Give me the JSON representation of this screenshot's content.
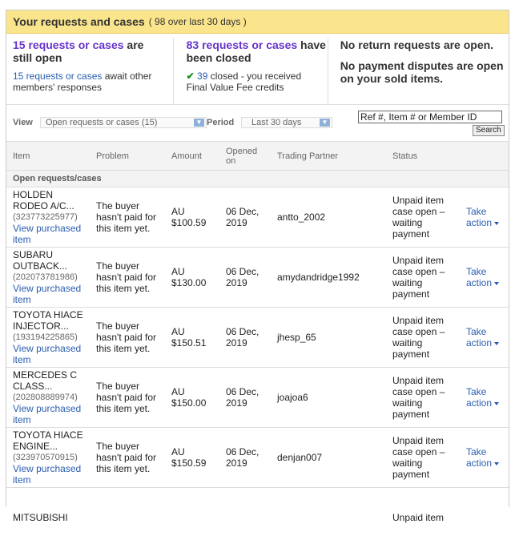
{
  "header": {
    "title": "Your requests and cases",
    "subtitle": "( 98 over last 30 days )"
  },
  "summary": {
    "open_count": "15 requests or cases",
    "open_suffix": "are",
    "open_line2": "still open",
    "await_link": "15 requests or cases",
    "await_text": "await other members' responses",
    "closed_count": "83 requests or cases",
    "closed_suffix": "have",
    "closed_line2": "been closed",
    "closed_check": "✔",
    "closed_num": "39",
    "closed_text": "closed - you received",
    "closed_text2": "Final Value Fee credits",
    "return_msg": "No return requests are open.",
    "dispute_msg": "No payment disputes are open on your sold items."
  },
  "filter": {
    "view_label": "View",
    "view_value": "Open requests or cases (15)",
    "period_label": "Period",
    "period_value": "Last 30 days",
    "search_placeholder": "Ref #, Item # or Member ID",
    "search_button": "Search"
  },
  "columns": [
    "Item",
    "Problem",
    "Amount",
    "Opened on",
    "Trading Partner",
    "Status"
  ],
  "group_label": "Open requests/cases",
  "rows": [
    {
      "name1": "HOLDEN",
      "name2": "RODEO A/C...",
      "num": "(323773225977)",
      "view": "View purchased item",
      "problem": "The buyer hasn't paid for this item yet.",
      "amount1": "AU",
      "amount2": "$100.59",
      "date1": "06 Dec,",
      "date2": "2019",
      "partner": "antto_2002",
      "status": "Unpaid item case open – waiting payment",
      "take1": "Take",
      "take2": "action"
    },
    {
      "name1": "SUBARU",
      "name2": "OUTBACK...",
      "num": "(202073781986)",
      "view": "View purchased item",
      "problem": "The buyer hasn't paid for this item yet.",
      "amount1": "AU",
      "amount2": "$130.00",
      "date1": "06 Dec,",
      "date2": "2019",
      "partner": "amydandridge1992",
      "status": "Unpaid item case open – waiting payment",
      "take1": "Take",
      "take2": "action"
    },
    {
      "name1": "TOYOTA HIACE",
      "name2": "INJECTOR...",
      "num": "(193194225865)",
      "view": "View purchased item",
      "problem": "The buyer hasn't paid for this item yet.",
      "amount1": "AU",
      "amount2": "$150.51",
      "date1": "06 Dec,",
      "date2": "2019",
      "partner": "jhesp_65",
      "status": "Unpaid item case open – waiting payment",
      "take1": "Take",
      "take2": "action"
    },
    {
      "name1": "MERCEDES C",
      "name2": "CLASS...",
      "num": "(202808889974)",
      "view": "View purchased item",
      "problem": "The buyer hasn't paid for this item yet.",
      "amount1": "AU",
      "amount2": "$150.00",
      "date1": "06 Dec,",
      "date2": "2019",
      "partner": "joajoa6",
      "status": "Unpaid item case open – waiting payment",
      "take1": "Take",
      "take2": "action"
    },
    {
      "name1": "TOYOTA HIACE",
      "name2": "ENGINE...",
      "num": "(323970570915)",
      "view": "View purchased item",
      "problem": "The buyer hasn't paid for this item yet.",
      "amount1": "AU",
      "amount2": "$150.59",
      "date1": "06 Dec,",
      "date2": "2019",
      "partner": "denjan007",
      "status": "Unpaid item case open – waiting payment",
      "take1": "Take",
      "take2": "action"
    },
    {
      "name1": "MITSUBISHI",
      "name2": "",
      "num": "",
      "view": "",
      "problem": "",
      "amount1": "",
      "amount2": "",
      "date1": "",
      "date2": "",
      "partner": "",
      "status": "Unpaid item",
      "take1": "",
      "take2": ""
    }
  ]
}
